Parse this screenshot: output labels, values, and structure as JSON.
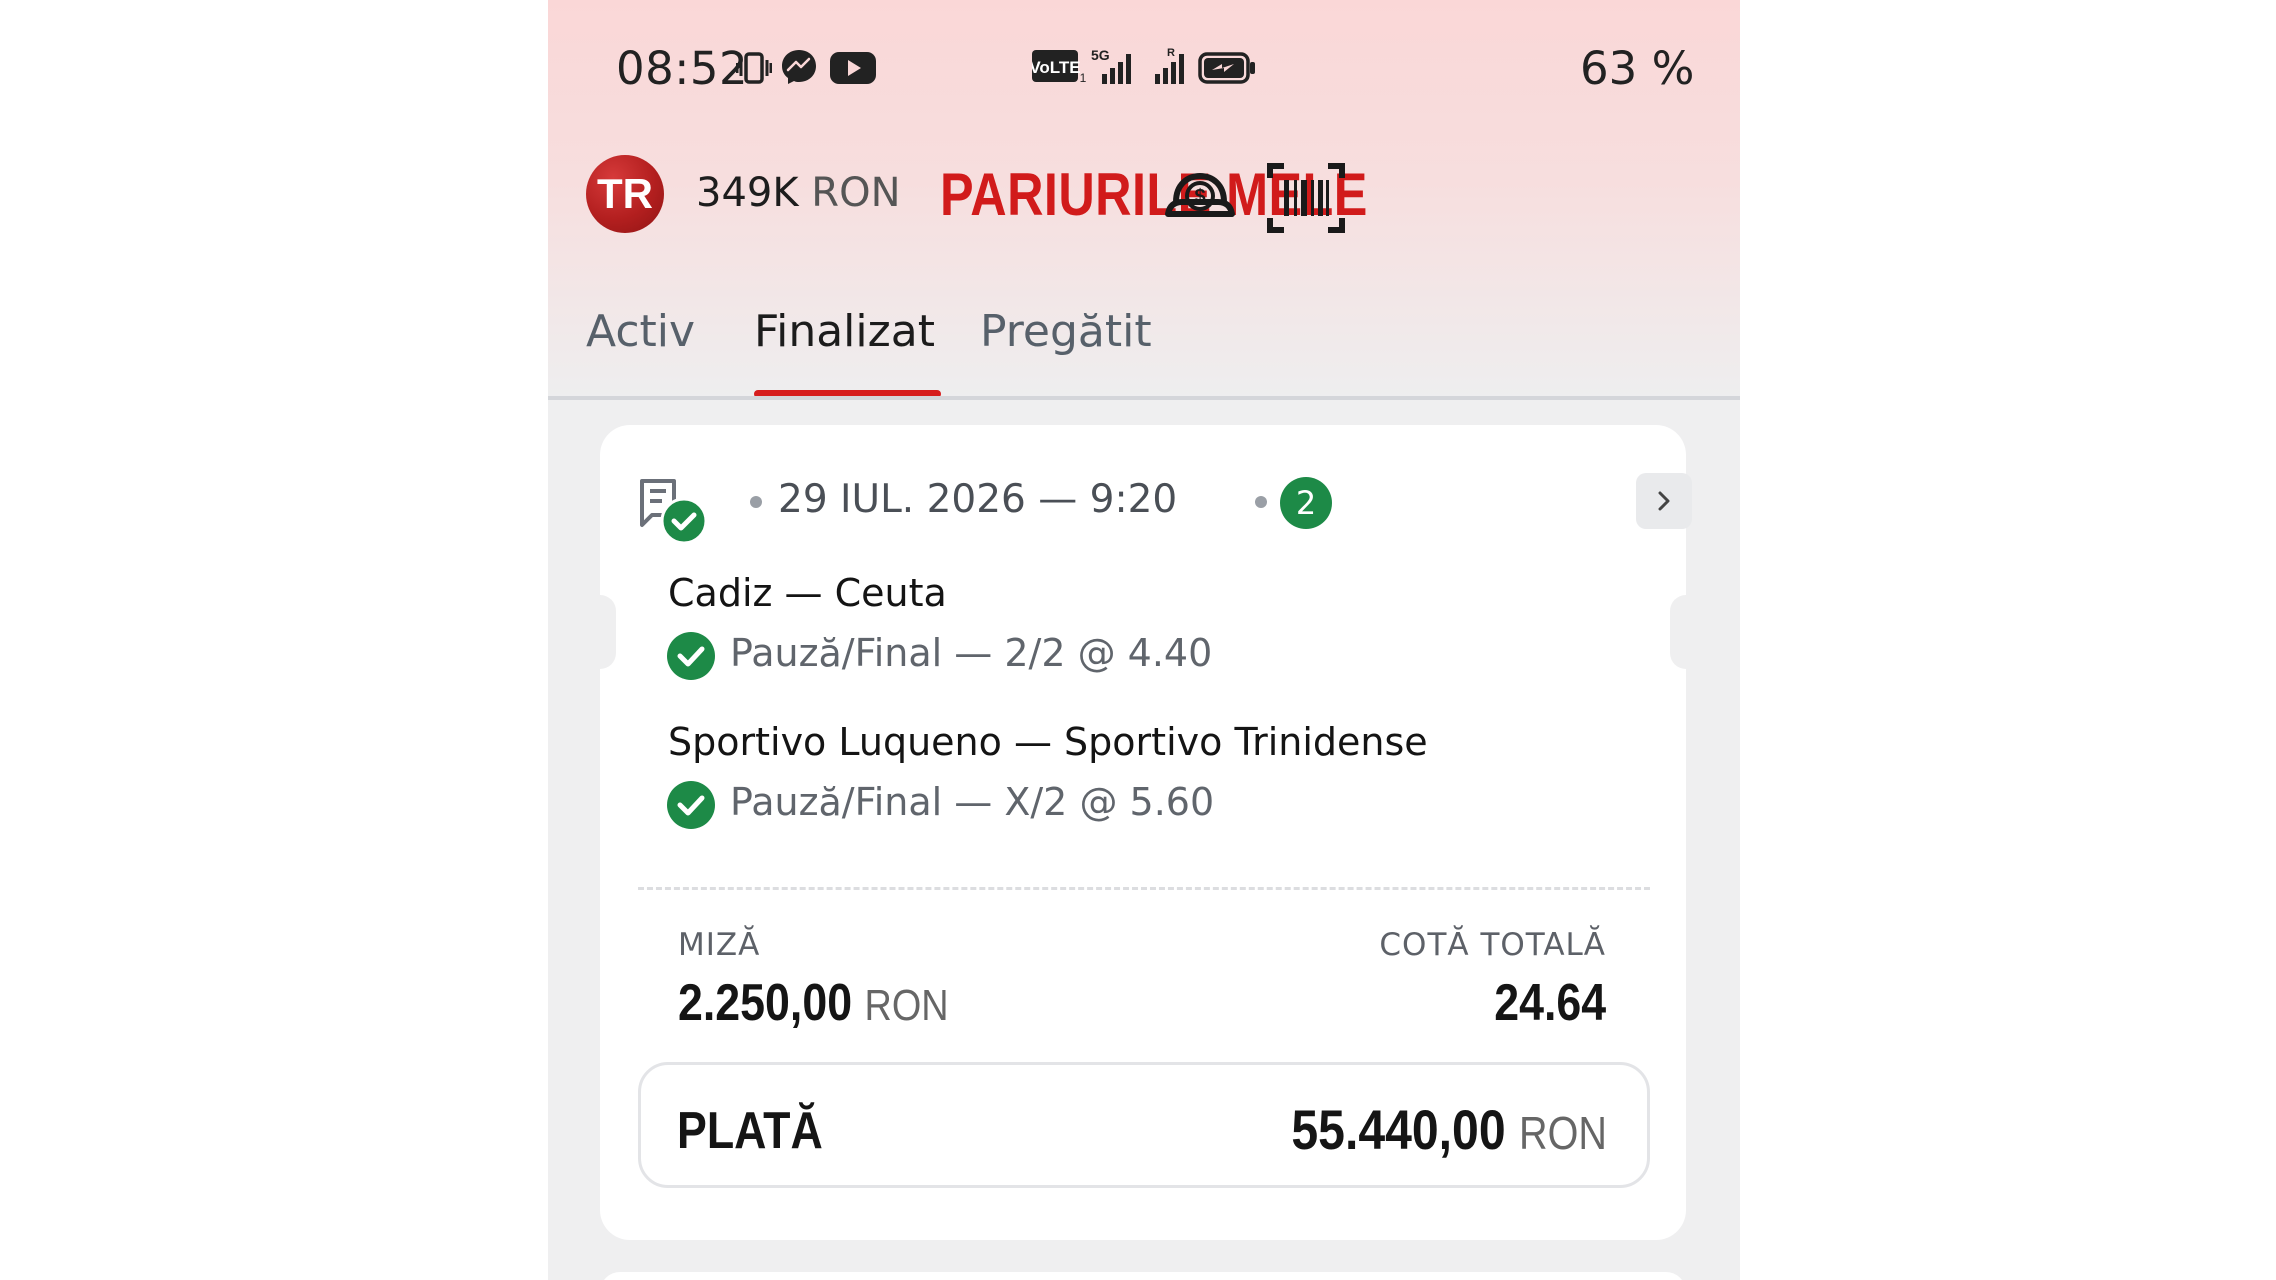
{
  "status_bar": {
    "time": "08:52",
    "battery_percent": "63 %",
    "icons": [
      "vibrate-icon",
      "messenger-icon",
      "youtube-icon",
      "volte-icon",
      "5g-signal-icon",
      "roaming-signal-icon",
      "battery-charging-icon"
    ],
    "volte_label": "VoLTE",
    "network_label": "5G"
  },
  "app_bar": {
    "avatar_initials": "TR",
    "balance_amount": "349K",
    "balance_currency": "RON",
    "title": "PARIURILE MELE",
    "icons": [
      "money-bag-icon",
      "barcode-scan-icon"
    ],
    "brand_color": "#d11b1b"
  },
  "tabs": [
    {
      "label": "Activ",
      "active": false
    },
    {
      "label": "Finalizat",
      "active": true
    },
    {
      "label": "Pregătit",
      "active": false
    }
  ],
  "bet_card": {
    "date": "29 IUL. 2026 — 9:20",
    "selections_count": "2",
    "events": [
      {
        "name": "Cadiz — Ceuta",
        "selection": "Pauză/Final — 2/2 @ 4.40",
        "status": "won"
      },
      {
        "name": "Sportivo Luqueno — Sportivo Trinidense",
        "selection": "Pauză/Final — X/2 @ 5.60",
        "status": "won"
      }
    ],
    "stake_label": "MIZĂ",
    "stake_amount": "2.250,00",
    "stake_currency": "RON",
    "total_odds_label": "COTĂ TOTALĂ",
    "total_odds": "24.64",
    "payout_label": "PLATĂ",
    "payout_amount": "55.440,00",
    "payout_currency": "RON",
    "win_color": "#1d8a47"
  }
}
